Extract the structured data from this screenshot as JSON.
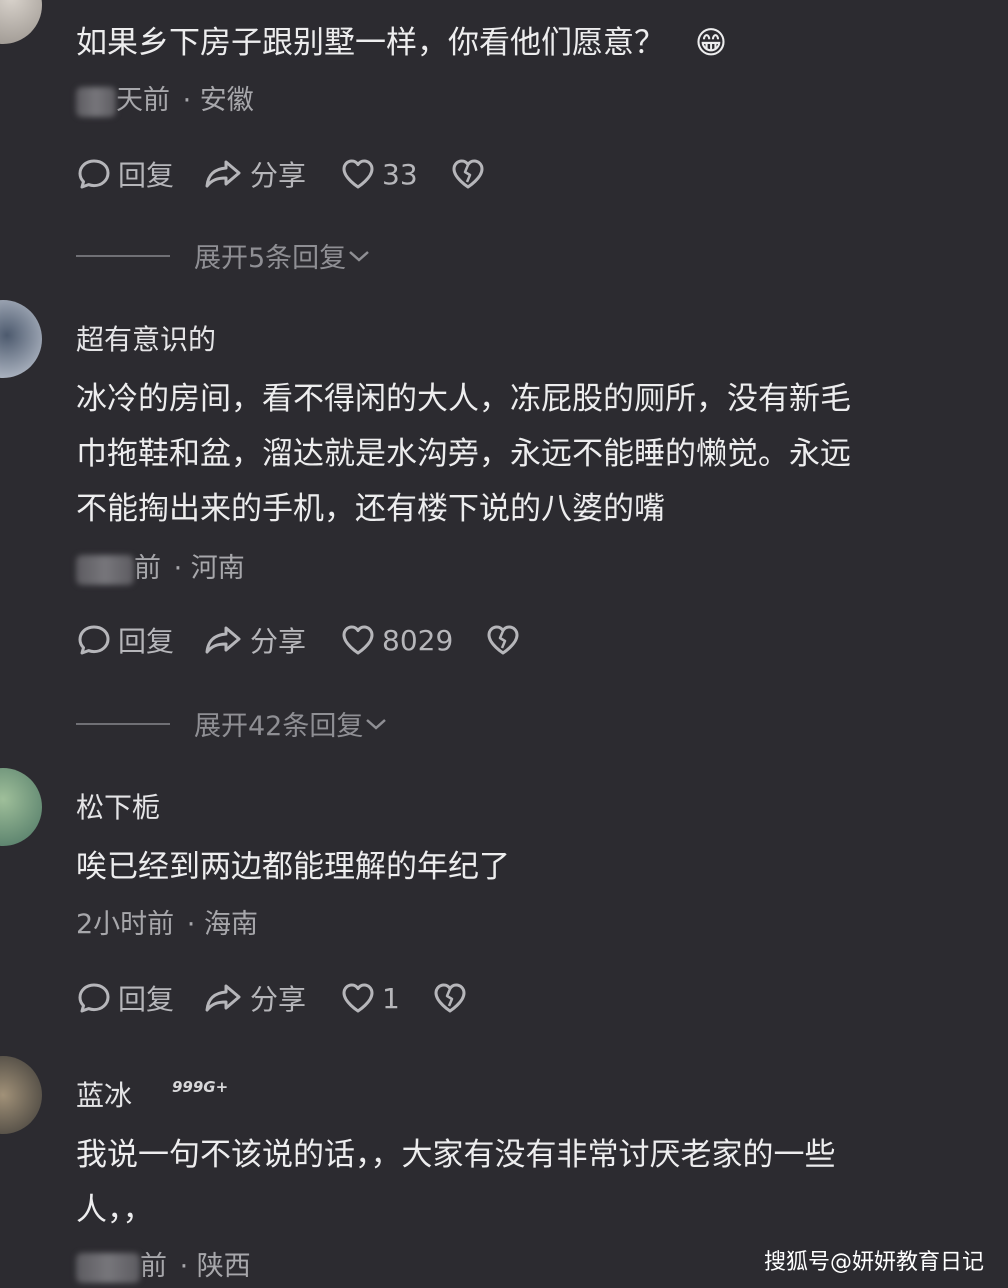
{
  "actions": {
    "reply": "回复",
    "share": "分享"
  },
  "comments": [
    {
      "content": "如果乡下房子跟别墅一样，你看他们愿意？",
      "emoji": "😁",
      "time": "天前",
      "location": "· 安徽",
      "likes": "33",
      "expand": "展开5条回复"
    },
    {
      "username": "超有意识的",
      "content_lines": [
        "冰冷的房间，看不得闲的大人，冻屁股的厕所，没有新毛",
        "巾拖鞋和盆，溜达就是水沟旁，永远不能睡的懒觉。永远",
        "不能掏出来的手机，还有楼下说的八婆的嘴"
      ],
      "time": "前",
      "location": "· 河南",
      "likes": "8029",
      "expand": "展开42条回复"
    },
    {
      "username": "松下栀",
      "content": "唉已经到两边都能理解的年纪了",
      "time": "2小时前",
      "location": "· 海南",
      "likes": "1"
    },
    {
      "username": "蓝冰",
      "badge": "999G+",
      "content_lines": [
        "我说一句不该说的话，，大家有没有非常讨厌老家的一些",
        "人，，"
      ],
      "time": "前",
      "location": "· 陕西"
    }
  ],
  "watermark": "搜狐号@妍妍教育日记"
}
